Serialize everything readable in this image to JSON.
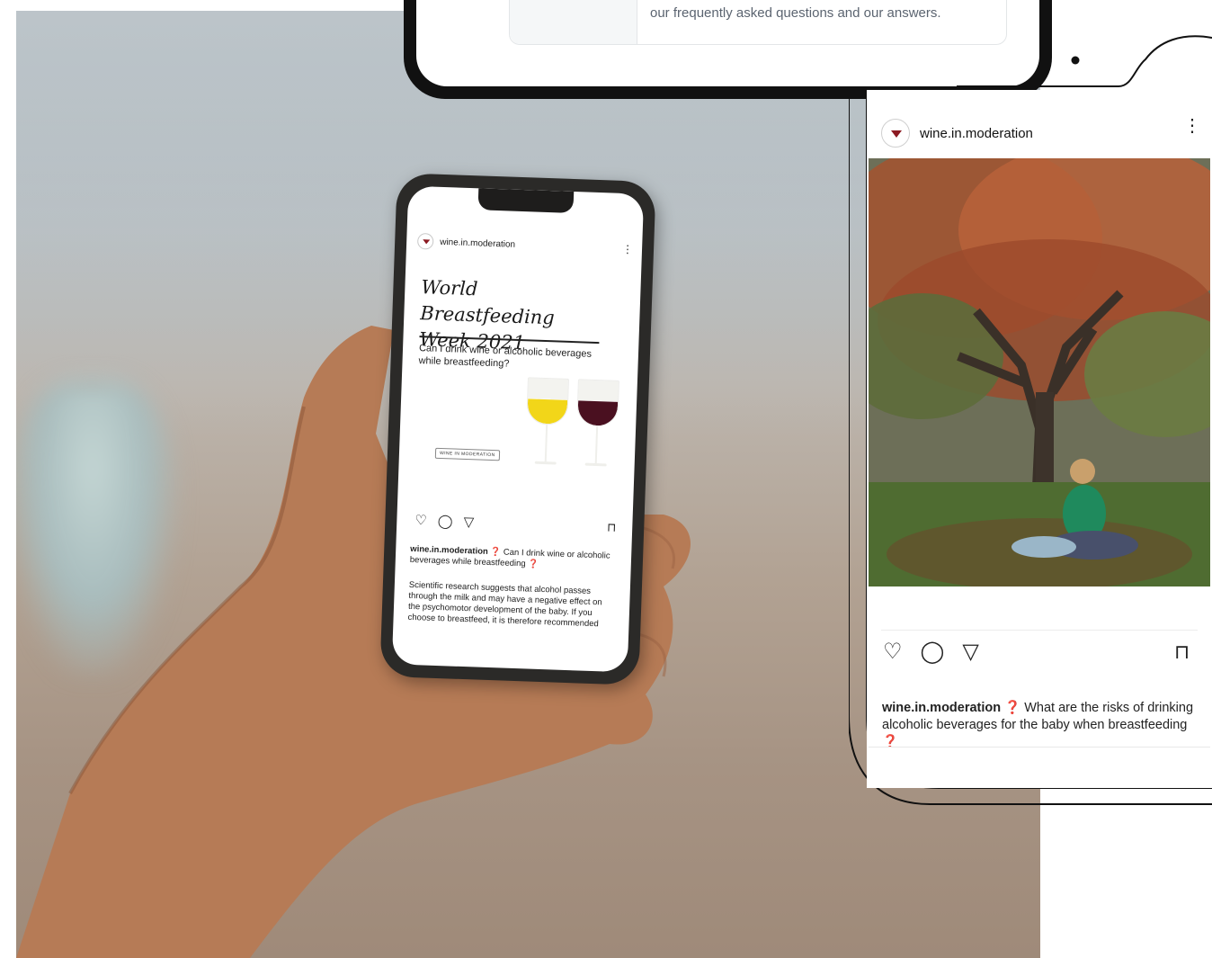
{
  "tablet": {
    "faq_text": "our frequently asked questions and our answers."
  },
  "hand_phone": {
    "username": "wine.in.moderation",
    "post_title_line1": "World Breastfeeding",
    "post_title_line2": "Week 2021",
    "post_question": "Can I drink wine or alcoholic beverages while breastfeeding?",
    "logo_text": "WINE IN MODERATION",
    "caption_username": "wine.in.moderation",
    "caption_text": " ❓ Can I drink wine or alcoholic beverages while breastfeeding ❓",
    "body_text": "Scientific research suggests that alcohol passes through the milk and may have a negative effect on the psychomotor development of the baby. If you choose to breastfeed, it is therefore recommended",
    "glass_colors": {
      "white_wine": "#f2d619",
      "red_wine": "#4a1020"
    }
  },
  "right_phone": {
    "username": "wine.in.moderation",
    "caption_username": "wine.in.moderation",
    "caption_text": " ❓ What are the risks of drinking alcoholic beverages for the baby when breastfeeding ❓"
  },
  "icons": [
    "heart-icon",
    "comment-icon",
    "send-icon",
    "bookmark-icon",
    "more-icon"
  ]
}
